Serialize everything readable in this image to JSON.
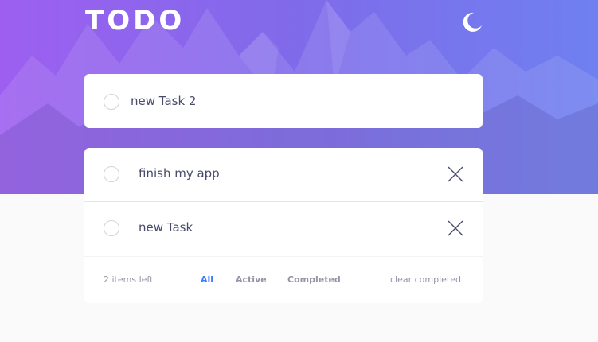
{
  "header": {
    "title": "TODO",
    "theme_icon": "moon-icon"
  },
  "new_todo": {
    "value": "new Task 2",
    "check_icon": "circle-icon"
  },
  "todos": [
    {
      "text": "finish my app",
      "completed": false,
      "delete_icon": "close-icon"
    },
    {
      "text": "new Task",
      "completed": false,
      "delete_icon": "close-icon"
    }
  ],
  "footer": {
    "items_left": "2 items left",
    "filters": [
      "All",
      "Active",
      "Completed"
    ],
    "active_filter": "All",
    "clear_label": "clear completed"
  },
  "colors": {
    "gradient_start": "#9d5ff0",
    "gradient_end": "#6f80f0",
    "accent": "#3a7bfd",
    "text": "#484b6a",
    "muted": "#9394a5",
    "background": "#fafafa"
  }
}
